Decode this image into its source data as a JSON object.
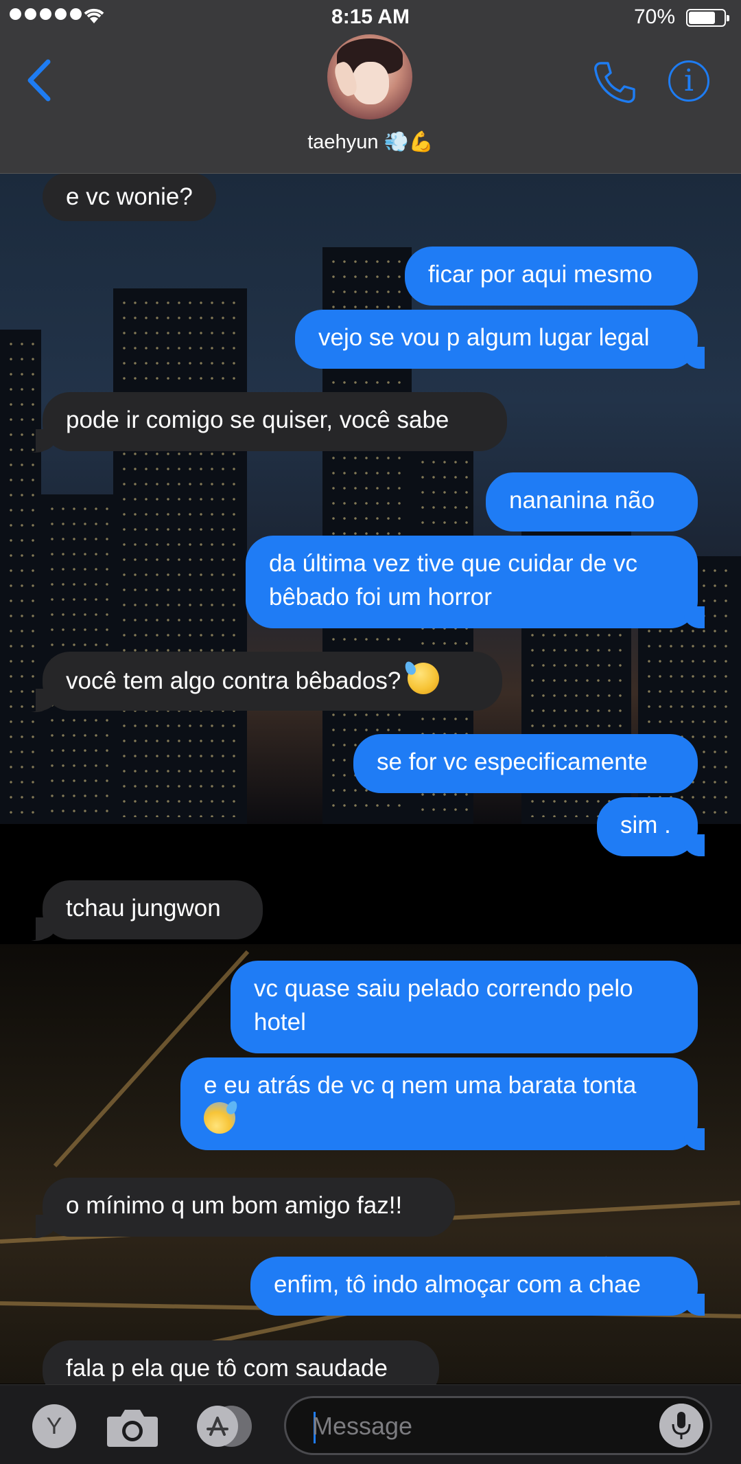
{
  "status_bar": {
    "time": "8:15 AM",
    "battery_text": "70%",
    "battery_level": 0.7,
    "signal_bars": 5
  },
  "header": {
    "contact_name": "taehyun 💨💪",
    "back_icon": "chevron-left-icon",
    "call_icon": "phone-icon",
    "info_icon": "info-icon",
    "info_glyph": "i",
    "accent_color": "#1e7cf2"
  },
  "messages": [
    {
      "side": "in",
      "text": "e vc wonie?"
    },
    {
      "side": "out",
      "text": "ficar por aqui mesmo"
    },
    {
      "side": "out",
      "text": "vejo se vou p algum lugar legal"
    },
    {
      "side": "in",
      "text": "pode ir comigo se quiser, você sabe"
    },
    {
      "side": "out",
      "text": "nananina não"
    },
    {
      "side": "out",
      "text": "da última vez tive que cuidar de vc bêbado foi um horror"
    },
    {
      "side": "in",
      "text": "você tem algo contra bêbados?",
      "emoji": "downcast-sweat-face"
    },
    {
      "side": "out",
      "text": "se for vc especificamente"
    },
    {
      "side": "out",
      "text": "sim ."
    },
    {
      "side": "in",
      "text": "tchau jungwon"
    },
    {
      "side": "out",
      "text": "vc quase saiu pelado correndo pelo hotel"
    },
    {
      "side": "out",
      "text": "e eu atrás de vc q nem uma barata tonta",
      "emoji": "anxious-sweat-face"
    },
    {
      "side": "in",
      "text": "o mínimo q um bom amigo faz!!"
    },
    {
      "side": "out",
      "text": "enfim, tô indo almoçar com a chae"
    },
    {
      "side": "in",
      "text": "fala p ela que tô com saudade"
    }
  ],
  "input_bar": {
    "app_button_label": "Y",
    "camera_icon": "camera-icon",
    "appstore_icon": "app-store-icon",
    "placeholder": "Message",
    "mic_icon": "microphone-icon"
  },
  "colors": {
    "outgoing_bubble": "#1f7cf5",
    "incoming_bubble": "#262628",
    "header_bg": "#3a3a3c"
  }
}
